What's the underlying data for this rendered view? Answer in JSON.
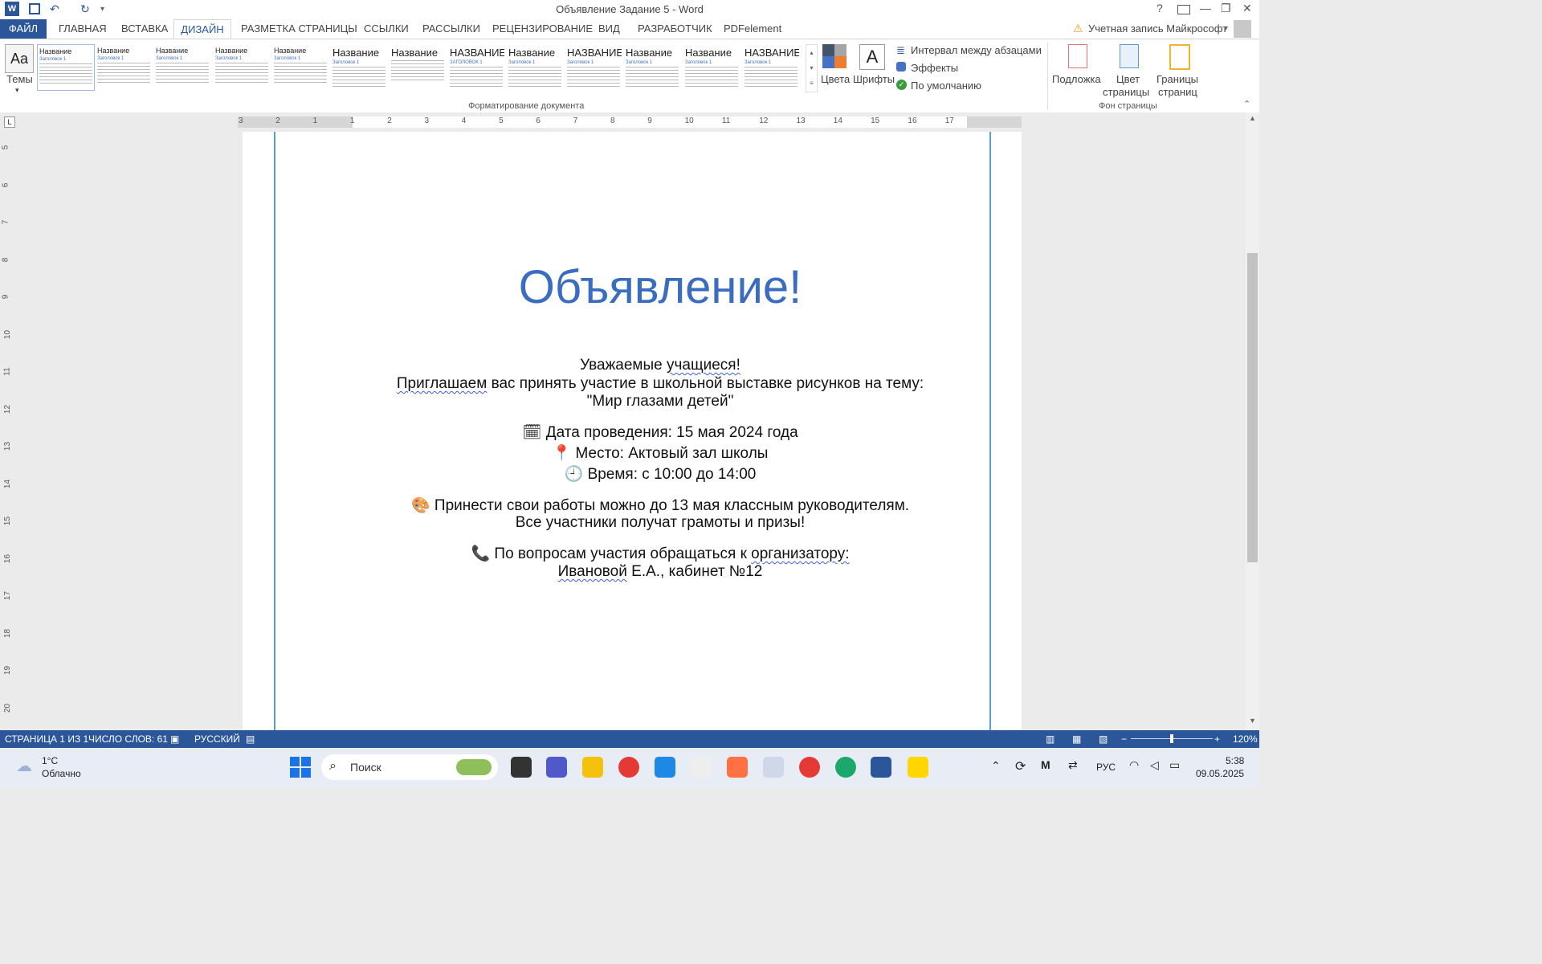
{
  "window": {
    "title": "Объявление Задание 5 - Word",
    "help": "?",
    "minimize": "—",
    "restore": "❐",
    "close": "✕"
  },
  "quick_access": {
    "undo": "↶",
    "redo": "↻",
    "customize": "▾"
  },
  "tabs": {
    "file": "ФАЙЛ",
    "items": [
      "ГЛАВНАЯ",
      "ВСТАВКА",
      "ДИЗАЙН",
      "РАЗМЕТКА СТРАНИЦЫ",
      "ССЫЛКИ",
      "РАССЫЛКИ",
      "РЕЦЕНЗИРОВАНИЕ",
      "ВИД",
      "РАЗРАБОТЧИК",
      "PDFelement"
    ],
    "account": "Учетная запись Майкрософт"
  },
  "ribbon": {
    "themes_label": "Темы",
    "gallery_names": [
      "Название",
      "Название",
      "Название",
      "Название",
      "Название",
      "Название",
      "Название",
      "НАЗВАНИЕ",
      "Название",
      "НАЗВАНИЕ",
      "Название",
      "Название",
      "НАЗВАНИЕ"
    ],
    "gallery_sub": [
      "Заголовок 1",
      "Заголовок 1",
      "Заголовок 1",
      "Заголовок 1",
      "Заголовок 1",
      "Заголовок 1",
      "",
      "ЗАГОЛОВОК 1",
      "Заголовок 1",
      "Заголовок 1",
      "Заголовок 1",
      "Заголовок 1",
      "Заголовок 1"
    ],
    "colors_label": "Цвета",
    "fonts_label": "Шрифты",
    "fonts_glyph": "A",
    "paragraph_spacing": "Интервал между абзацами",
    "effects": "Эффекты",
    "set_default": "По умолчанию",
    "group_doc_format": "Форматирование документа",
    "watermark": "Подложка",
    "page_color_1": "Цвет",
    "page_color_2": "страницы",
    "page_borders_1": "Границы",
    "page_borders_2": "страниц",
    "group_page_bg": "Фон страницы"
  },
  "ruler": {
    "h_numbers": [
      "3",
      "2",
      "1",
      "1",
      "2",
      "3",
      "4",
      "5",
      "6",
      "7",
      "8",
      "9",
      "10",
      "11",
      "12",
      "13",
      "14",
      "15",
      "16",
      "17"
    ],
    "v_numbers": [
      "5",
      "6",
      "7",
      "8",
      "9",
      "10",
      "11",
      "12",
      "13",
      "14",
      "15",
      "16",
      "17",
      "18",
      "19",
      "20"
    ]
  },
  "document": {
    "heading": "Объявление!",
    "greeting_pre": "Уважаемые ",
    "greeting_word": "учащиеся!",
    "invite_word": "Приглашаем",
    "invite_rest": " вас принять участие в школьной выставке рисунков на тему:",
    "theme": "\"Мир глазами детей\"",
    "date_icon": "🗓",
    "date": "Дата проведения: 15 мая 2024 года",
    "place_icon": "📍",
    "place": "Место: Актовый зал школы",
    "time_icon": "🕘",
    "time": "Время: с 10:00 до 14:00",
    "submit_icon": "🎨",
    "submit": "Принести свои работы можно до 13 мая классным руководителям.",
    "prizes": "Все участники получат грамоты и призы!",
    "contact_icon": "📞",
    "contact_pre": "По вопросам участия обращаться к ",
    "contact_word": "организатору:",
    "organizer_word": "Ивановой",
    "organizer_rest": " Е.А., кабинет №12"
  },
  "status": {
    "page": "СТРАНИЦА 1 ИЗ 1",
    "words": "ЧИСЛО СЛОВ: 61",
    "language": "РУССКИЙ",
    "zoom": "120%"
  },
  "taskbar": {
    "weather_temp": "1°C",
    "weather_desc": "Облачно",
    "search_placeholder": "Поиск",
    "lang": "РУС",
    "time": "5:38",
    "date": "09.05.2025"
  }
}
